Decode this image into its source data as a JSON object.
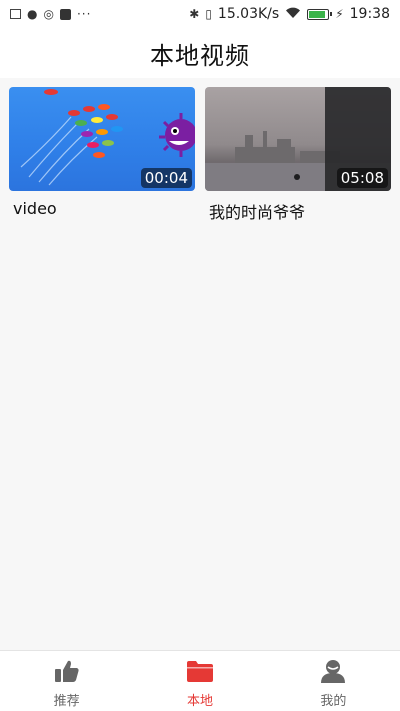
{
  "status_bar": {
    "network_speed": "15.03K/s",
    "time": "19:38",
    "battery_level": 0.9,
    "dots": "···"
  },
  "header": {
    "title": "本地视频"
  },
  "videos": [
    {
      "title": "video",
      "duration": "00:04"
    },
    {
      "title": "我的时尚爷爷",
      "duration": "05:08"
    }
  ],
  "tabbar": {
    "tabs": [
      {
        "label": "推荐",
        "icon": "thumbs-up-icon",
        "active": false
      },
      {
        "label": "本地",
        "icon": "folder-icon",
        "active": true
      },
      {
        "label": "我的",
        "icon": "user-icon",
        "active": false
      }
    ]
  },
  "colors": {
    "accent": "#e53935",
    "inactive": "#666666"
  }
}
